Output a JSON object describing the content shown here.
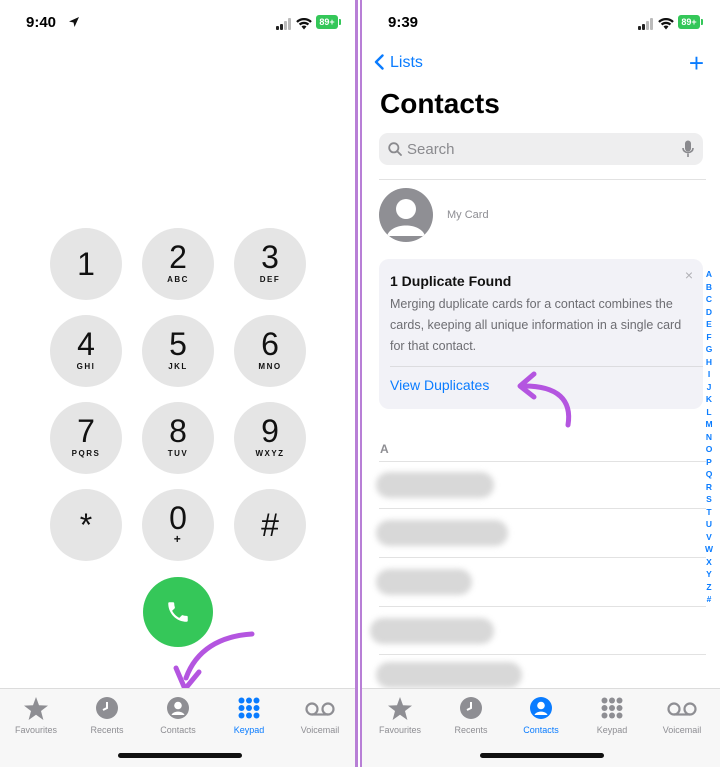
{
  "left_phone": {
    "status": {
      "time": "9:40",
      "battery": "89+"
    },
    "keypad": [
      {
        "digit": "1",
        "letters": ""
      },
      {
        "digit": "2",
        "letters": "ABC"
      },
      {
        "digit": "3",
        "letters": "DEF"
      },
      {
        "digit": "4",
        "letters": "GHI"
      },
      {
        "digit": "5",
        "letters": "JKL"
      },
      {
        "digit": "6",
        "letters": "MNO"
      },
      {
        "digit": "7",
        "letters": "PQRS"
      },
      {
        "digit": "8",
        "letters": "TUV"
      },
      {
        "digit": "9",
        "letters": "WXYZ"
      },
      {
        "digit": "*",
        "letters": ""
      },
      {
        "digit": "0",
        "letters": "+"
      },
      {
        "digit": "#",
        "letters": ""
      }
    ],
    "tabs": [
      {
        "label": "Favourites",
        "icon": "star-icon",
        "active": false
      },
      {
        "label": "Recents",
        "icon": "clock-icon",
        "active": false
      },
      {
        "label": "Contacts",
        "icon": "person-circle-icon",
        "active": false
      },
      {
        "label": "Keypad",
        "icon": "keypad-grid-icon",
        "active": true
      },
      {
        "label": "Voicemail",
        "icon": "voicemail-icon",
        "active": false
      }
    ]
  },
  "right_phone": {
    "status": {
      "time": "9:39",
      "battery": "89+"
    },
    "nav": {
      "back_label": "Lists",
      "add_label": "+"
    },
    "title": "Contacts",
    "search": {
      "placeholder": "Search"
    },
    "my_card": {
      "label": "My Card"
    },
    "duplicate": {
      "title": "1 Duplicate Found",
      "body": "Merging duplicate cards for a contact combines the cards, keeping all unique information in a single card for that contact.",
      "close": "×",
      "link": "View Duplicates"
    },
    "section_letter": "A",
    "index_letters": [
      "A",
      "B",
      "C",
      "D",
      "E",
      "F",
      "G",
      "H",
      "I",
      "J",
      "K",
      "L",
      "M",
      "N",
      "O",
      "P",
      "Q",
      "R",
      "S",
      "T",
      "U",
      "V",
      "W",
      "X",
      "Y",
      "Z",
      "#"
    ],
    "tabs": [
      {
        "label": "Favourites",
        "icon": "star-icon",
        "active": false
      },
      {
        "label": "Recents",
        "icon": "clock-icon",
        "active": false
      },
      {
        "label": "Contacts",
        "icon": "person-circle-icon",
        "active": true
      },
      {
        "label": "Keypad",
        "icon": "keypad-grid-icon",
        "active": false
      },
      {
        "label": "Voicemail",
        "icon": "voicemail-icon",
        "active": false
      }
    ]
  },
  "colors": {
    "accent": "#0a7cff",
    "call_green": "#35c759",
    "annotation_purple": "#b455e0",
    "battery_green": "#34c759"
  }
}
